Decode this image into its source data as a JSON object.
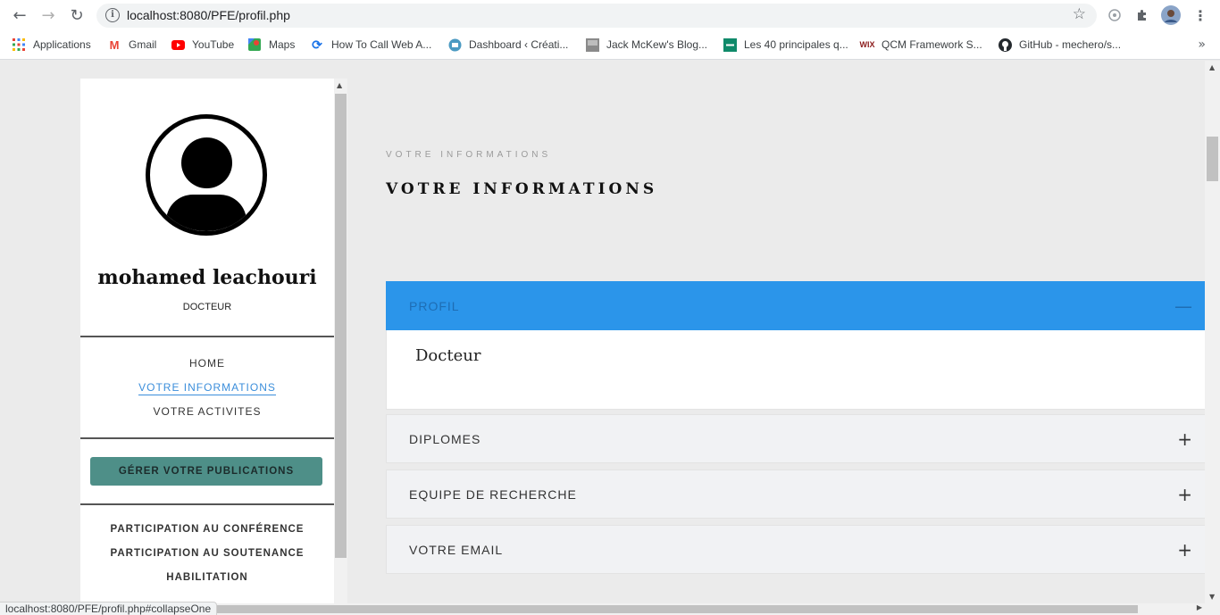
{
  "browser": {
    "url": "localhost:8080/PFE/profil.php",
    "status_url": "localhost:8080/PFE/profil.php#collapseOne"
  },
  "bookmarks": [
    {
      "label": "Applications",
      "icon": "apps-grid-icon"
    },
    {
      "label": "Gmail",
      "icon": "gmail-icon"
    },
    {
      "label": "YouTube",
      "icon": "youtube-icon"
    },
    {
      "label": "Maps",
      "icon": "maps-icon"
    },
    {
      "label": "How To Call Web A...",
      "icon": "refresh-link-icon"
    },
    {
      "label": "Dashboard ‹ Créati...",
      "icon": "dashboard-icon"
    },
    {
      "label": "Jack McKew's Blog...",
      "icon": "blog-icon"
    },
    {
      "label": "Les 40 principales q...",
      "icon": "list-icon"
    },
    {
      "label": "QCM Framework S...",
      "icon": "qcm-icon"
    },
    {
      "label": "GitHub - mechero/s...",
      "icon": "github-icon"
    }
  ],
  "sidebar": {
    "user_name": "mohamed leachouri",
    "user_role": "DOCTEUR",
    "nav": [
      {
        "label": "HOME"
      },
      {
        "label": "VOTRE INFORMATIONS"
      },
      {
        "label": "VOTRE ACTIVITES"
      }
    ],
    "manage_button": "GÉRER VOTRE PUBLICATIONS",
    "sections": [
      {
        "label": "PARTICIPATION AU CONFÉRENCE"
      },
      {
        "label": "PARTICIPATION AU SOUTENANCE"
      },
      {
        "label": "HABILITATION"
      }
    ]
  },
  "main": {
    "sup_title": "VOTRE INFORMATIONS",
    "title": "VOTRE INFORMATIONS",
    "accordion": [
      {
        "label": "PROFIL",
        "sign": "—",
        "content": "Docteur"
      },
      {
        "label": "DIPLOMES",
        "sign": "+"
      },
      {
        "label": "EQUIPE DE RECHERCHE",
        "sign": "+"
      },
      {
        "label": "VOTRE EMAIL",
        "sign": "+"
      }
    ]
  },
  "colors": {
    "accent": "#2b95ea",
    "button": "#4e8f88",
    "active_link": "#3b8edb"
  }
}
